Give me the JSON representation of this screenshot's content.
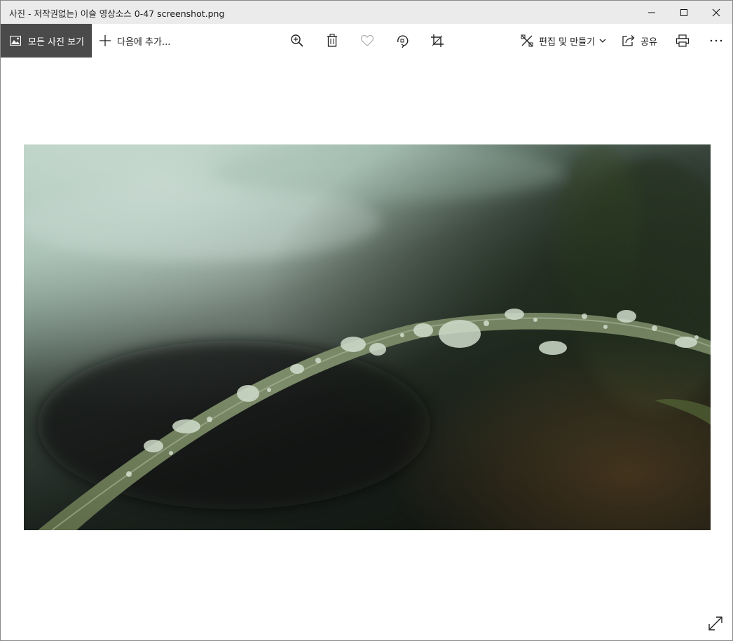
{
  "window": {
    "title": "사진 - 저작권없는) 이슬 영상소스 0-47 screenshot.png",
    "controls": [
      "minimize",
      "maximize",
      "close"
    ]
  },
  "toolbar": {
    "view_all_label": "모든 사진 보기",
    "add_to_label": "다음에 추가...",
    "edit_create_label": "편집 및 만들기",
    "share_label": "공유",
    "icons": [
      "zoom-in-icon",
      "delete-icon",
      "favorite-heart-icon",
      "rotate-icon",
      "crop-icon",
      "print-icon",
      "more-icon"
    ]
  },
  "photo": {
    "subject": "dew drops on grass blade",
    "colors": {
      "sky_top": "#b9cfc5",
      "mid": "#2f3a33",
      "dark": "#141a15",
      "leaf": "#6f7f5e",
      "rust": "#6a4a26"
    }
  },
  "corner": {
    "icon": "fullscreen-icon"
  }
}
